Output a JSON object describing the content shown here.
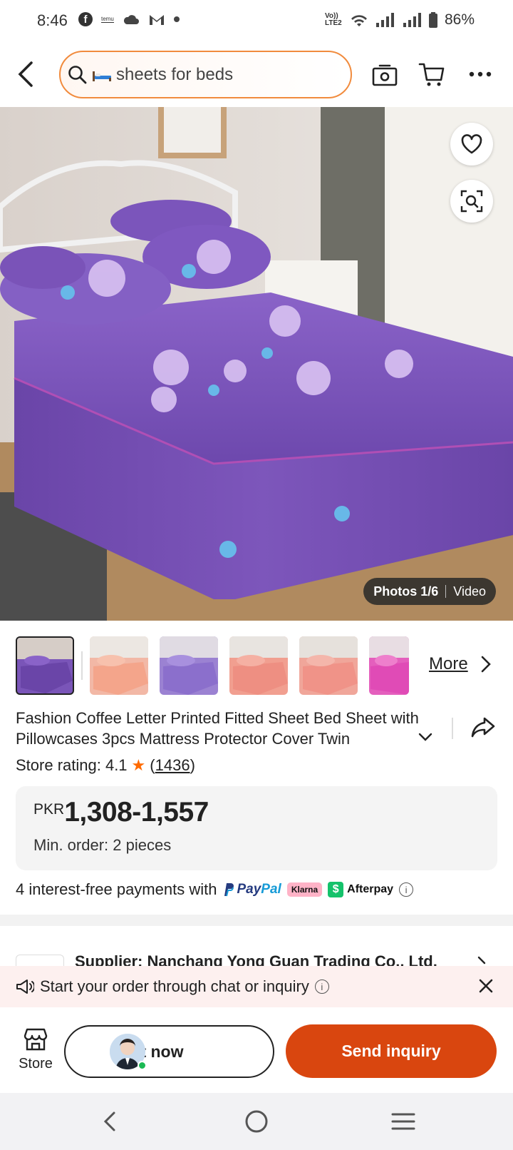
{
  "status_bar": {
    "time": "8:46",
    "app_mark": "temu",
    "network": "Vo)) LTE2",
    "battery": "86%"
  },
  "search": {
    "query": "sheets for beds"
  },
  "hero": {
    "photos_label": "Photos 1/6",
    "video_label": "Video"
  },
  "thumbnails": {
    "more_label": "More"
  },
  "product": {
    "title": "Fashion Coffee Letter Printed Fitted Sheet Bed Sheet with Pillowcases 3pcs Mattress Protector Cover Twin",
    "store_rating_label": "Store rating: 4.1",
    "rating_count": "1436",
    "currency": "PKR",
    "price_range": "1,308-1,557",
    "min_order": "Min. order: 2 pieces"
  },
  "payments": {
    "text": "4 interest-free payments with",
    "paypal_a": "Pay",
    "paypal_b": "Pal",
    "klarna": "Klarna",
    "afterpay": "Afterpay"
  },
  "supplier": {
    "label": "Supplier: Nanchang Yong Guan Trading Co., Ltd."
  },
  "banner": {
    "text": "Start your order through chat or inquiry"
  },
  "bottom_bar": {
    "store_label": "Store",
    "chat_label": "Chat now",
    "inquiry_label": "Send inquiry"
  },
  "colors": {
    "accent": "#d9460f",
    "search_border": "#f18b3d",
    "star": "#ff6a00",
    "bedding": "#7a55b8"
  }
}
